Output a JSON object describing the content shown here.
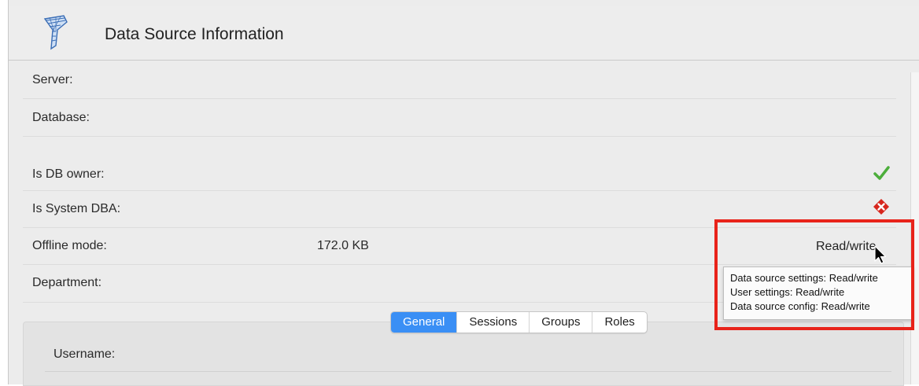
{
  "header": {
    "title": "Data Source Information",
    "icon": "data-source-funnel-icon"
  },
  "fields": [
    {
      "label": "Server:",
      "value": ""
    },
    {
      "label": "Database:",
      "value": ""
    },
    {
      "label": "Is DB owner:",
      "status_icon": "check-icon",
      "status_color": "#4cae3b"
    },
    {
      "label": "Is System DBA:",
      "status_icon": "error-icon",
      "status_color": "#d7261d"
    },
    {
      "label": "Offline mode:",
      "value": "172.0 KB",
      "right_value": "Read/write"
    },
    {
      "label": "Department:",
      "value": ""
    }
  ],
  "tooltip": {
    "lines": [
      "Data source settings: Read/write",
      "User settings: Read/write",
      "Data source config: Read/write"
    ]
  },
  "tabs": [
    {
      "label": "General",
      "active": true
    },
    {
      "label": "Sessions",
      "active": false
    },
    {
      "label": "Groups",
      "active": false
    },
    {
      "label": "Roles",
      "active": false
    }
  ],
  "panel": {
    "username_label": "Username:"
  },
  "colors": {
    "accent": "#3a8ff5",
    "highlight": "#e8231a"
  }
}
